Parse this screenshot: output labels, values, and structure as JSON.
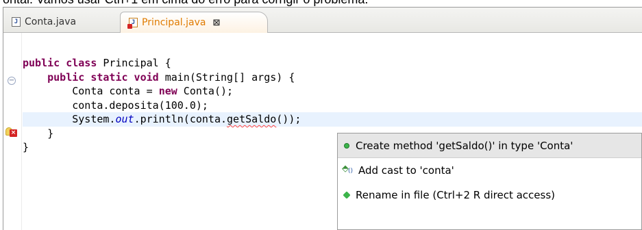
{
  "caption": {
    "text": "ontal. Vamos usar Ctrl+1 em cima do erro para corrigir o problema."
  },
  "tabs": [
    {
      "label": "Conta.java",
      "icon": "java-file-icon",
      "active": false
    },
    {
      "label": "Principal.java",
      "icon": "java-file-error-icon",
      "active": true,
      "close": "⊠"
    }
  ],
  "code": {
    "lines": [
      {
        "parts": [
          [
            "kw",
            "public class"
          ],
          [
            "plain",
            " Principal {"
          ]
        ]
      },
      {
        "parts": [
          [
            "plain",
            "    "
          ],
          [
            "kw",
            "public static void"
          ],
          [
            "plain",
            " main(String[] args) {"
          ]
        ]
      },
      {
        "parts": [
          [
            "plain",
            "        Conta conta = "
          ],
          [
            "kw",
            "new"
          ],
          [
            "plain",
            " Conta();"
          ]
        ]
      },
      {
        "parts": [
          [
            "plain",
            "        conta.deposita(100.0);"
          ]
        ]
      },
      {
        "parts": [
          [
            "plain",
            "        System."
          ],
          [
            "field",
            "out"
          ],
          [
            "plain",
            ".println(conta."
          ],
          [
            "err",
            "getSaldo"
          ],
          [
            "plain",
            "());"
          ]
        ]
      },
      {
        "parts": [
          [
            "plain",
            "    }"
          ]
        ]
      },
      {
        "parts": [
          [
            "plain",
            "}"
          ]
        ]
      }
    ],
    "current_line": 4,
    "error_line": 4,
    "fold_line": 1
  },
  "quickfix": {
    "items": [
      {
        "label": "Create method 'getSaldo()' in type 'Conta'",
        "icon": "create-method-icon",
        "selected": true
      },
      {
        "label": "Add cast to 'conta'",
        "icon": "add-cast-icon",
        "selected": false
      },
      {
        "label": "Rename in file (Ctrl+2 R direct access)",
        "icon": "rename-icon",
        "selected": false
      }
    ]
  },
  "colors": {
    "keyword": "#7f0055",
    "static_field": "#0000c0",
    "active_tab_text": "#e07b00",
    "current_line_bg": "#e8f2fe",
    "error_underline": "#ff4040"
  }
}
